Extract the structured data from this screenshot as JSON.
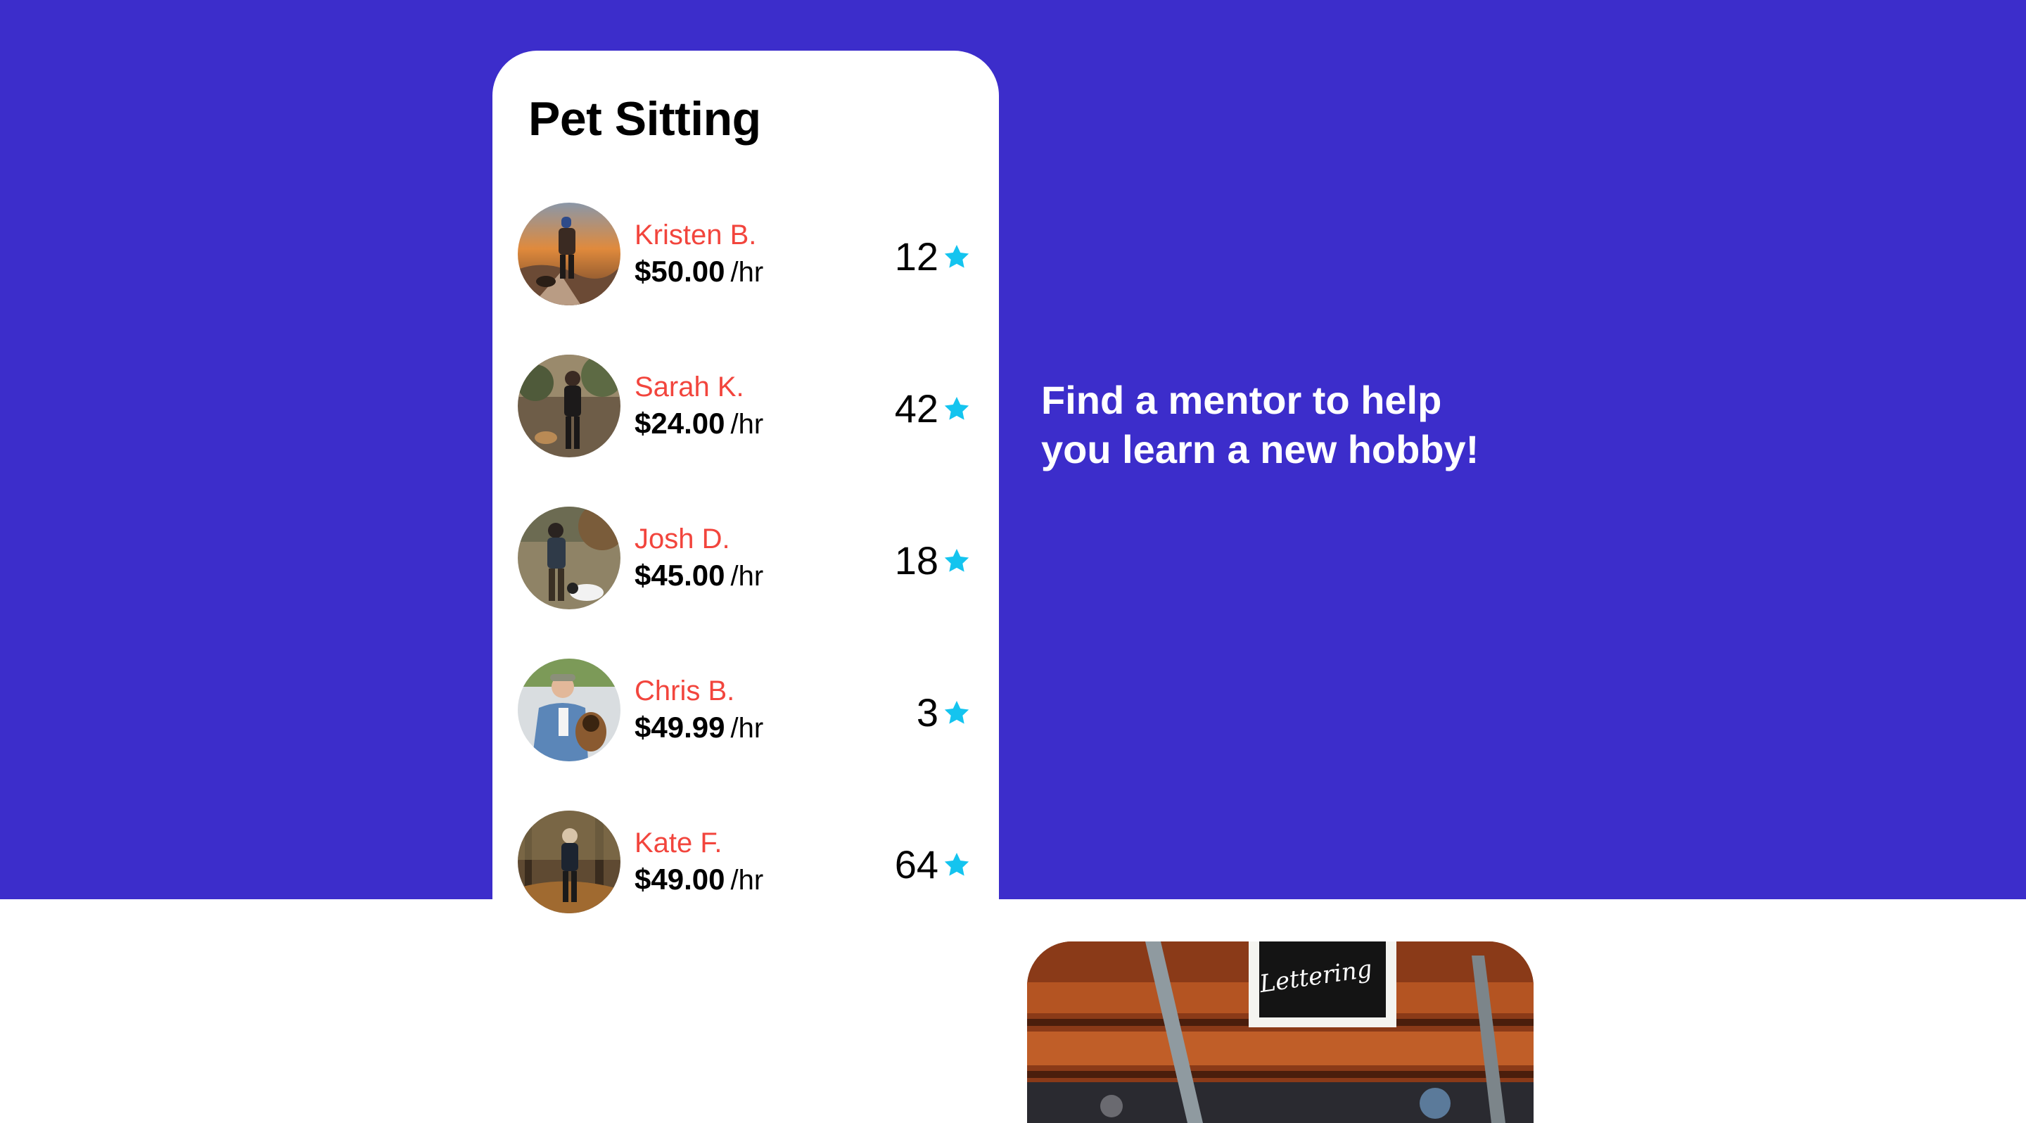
{
  "card": {
    "title": "Pet Sitting",
    "sitters": [
      {
        "name": "Kristen B.",
        "price": "$50.00",
        "unit": "/hr",
        "rating": "12",
        "avatar_icon": "person-hiking-photo"
      },
      {
        "name": "Sarah K.",
        "price": "$24.00",
        "unit": "/hr",
        "rating": "42",
        "avatar_icon": "person-with-dog-photo"
      },
      {
        "name": "Josh D.",
        "price": "$45.00",
        "unit": "/hr",
        "rating": "18",
        "avatar_icon": "person-field-dog-photo"
      },
      {
        "name": "Chris B.",
        "price": "$49.99",
        "unit": "/hr",
        "rating": "3",
        "avatar_icon": "person-with-dog-photo"
      },
      {
        "name": "Kate F.",
        "price": "$49.00",
        "unit": "/hr",
        "rating": "64",
        "avatar_icon": "person-forest-photo"
      }
    ],
    "star_icon": "star-icon"
  },
  "hero": {
    "tagline": "Find a mentor to help you learn a new hobby!"
  },
  "photo": {
    "sign_text": "Lettering"
  },
  "colors": {
    "brand": "#3c2dcb",
    "name": "#f2453d",
    "star": "#14c4ef",
    "card": "#ffffff"
  }
}
